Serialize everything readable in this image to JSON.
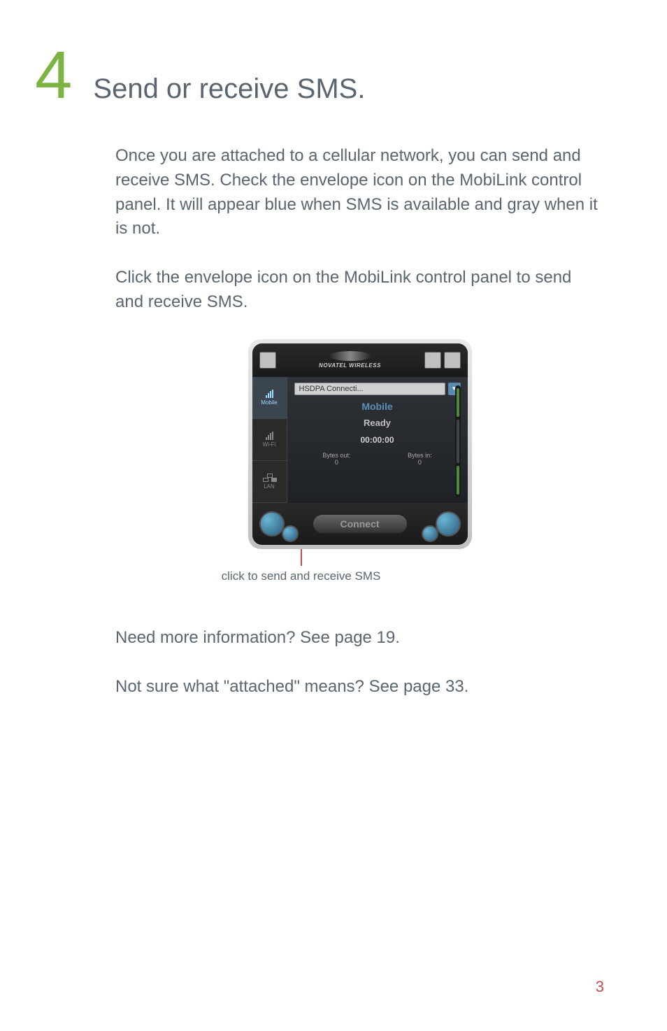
{
  "step": {
    "number": "4",
    "title": "Send or receive SMS."
  },
  "paragraphs": {
    "p1": "Once you are attached to a cellular network, you can send and receive SMS. Check the envelope icon on the MobiLink control panel. It will appear blue when SMS is available and gray when it is not.",
    "p2": "Click the envelope icon on the MobiLink control panel to send and receive SMS."
  },
  "device": {
    "brand": "NOVATEL WIRELESS",
    "dropdown": "HSDPA Connecti...",
    "carrier": "Mobile",
    "status": "Ready",
    "timer": "00:00:00",
    "bytes_out_label": "Bytes out:",
    "bytes_out_value": "0",
    "bytes_in_label": "Bytes in:",
    "bytes_in_value": "0",
    "connect_label": "Connect",
    "sidebar": {
      "mobile": "Mobile",
      "wifi": "Wi-Fi",
      "lan": "LAN"
    }
  },
  "callout": "click to send and receive SMS",
  "footer": {
    "info1": "Need more information? See page 19.",
    "info2": "Not sure what \"attached\" means? See page 33."
  },
  "page_number": "3"
}
